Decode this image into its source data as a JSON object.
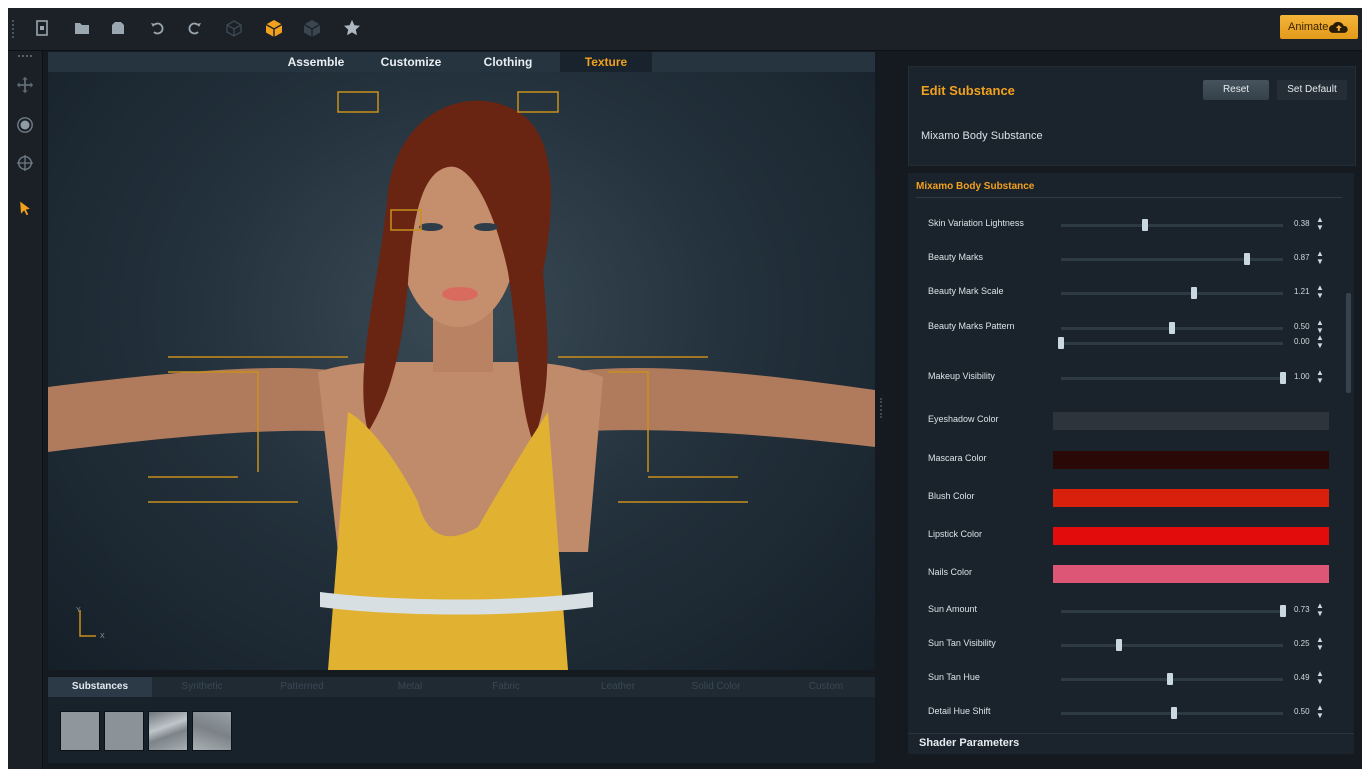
{
  "toolbar": {
    "icons": [
      "new-file-icon",
      "open-folder-icon",
      "save-icon",
      "undo-icon",
      "redo-icon",
      "wireframe-cube-icon",
      "solid-cube-icon",
      "textured-cube-icon",
      "star-icon"
    ],
    "animate_label": "Animate",
    "accent": "#f2a11e"
  },
  "left_tools": [
    "move-icon",
    "rotate-icon",
    "target-icon",
    "cursor-icon"
  ],
  "viewport": {
    "tabs": [
      {
        "label": "Assemble",
        "active": false
      },
      {
        "label": "Customize",
        "active": false
      },
      {
        "label": "Clothing",
        "active": false
      },
      {
        "label": "Texture",
        "active": true
      }
    ],
    "axis_y": "Y",
    "axis_x": "X"
  },
  "bottom_panel": {
    "tabs": [
      "Substances",
      "Synthetic",
      "Patterned",
      "Metal",
      "Fabric",
      "Leather",
      "Solid Color",
      "Custom"
    ],
    "active_tab": "Substances",
    "swatch_colors": [
      "#8f969c",
      "#8b9398",
      "#a1a8ad",
      "#9aa1a6"
    ]
  },
  "edit_substance": {
    "title": "Edit Substance",
    "reset_label": "Reset",
    "set_default_label": "Set Default",
    "substance_name": "Mixamo Body Substance"
  },
  "substance_panel": {
    "header": "Mixamo Body Substance",
    "params": [
      {
        "label": "Skin Variation Lightness",
        "kind": "slider",
        "value": "0.38",
        "fraction": 0.38
      },
      {
        "label": "Beauty Marks",
        "kind": "slider",
        "value": "0.87",
        "fraction": 0.84
      },
      {
        "label": "Beauty Mark Scale",
        "kind": "slider",
        "value": "1.21",
        "fraction": 0.6
      },
      {
        "label": "Beauty Marks Pattern",
        "kind": "slider",
        "value": "0.50",
        "fraction": 0.5
      },
      {
        "label": "",
        "kind": "slider",
        "value": "0.00",
        "fraction": 0.0
      },
      {
        "label": "Makeup Visibility",
        "kind": "slider",
        "value": "1.00",
        "fraction": 1.0
      },
      {
        "label": "Eyeshadow Color",
        "kind": "color",
        "color": "#2d343c"
      },
      {
        "label": "Mascara Color",
        "kind": "color",
        "color": "#2a0806"
      },
      {
        "label": "Blush Color",
        "kind": "color",
        "color": "#d8200d"
      },
      {
        "label": "Lipstick Color",
        "kind": "color",
        "color": "#e30c0c"
      },
      {
        "label": "Nails Color",
        "kind": "color",
        "color": "#dd5676"
      },
      {
        "label": "Sun Amount",
        "kind": "slider",
        "value": "0.73",
        "fraction": 1.0
      },
      {
        "label": "Sun Tan Visibility",
        "kind": "slider",
        "value": "0.25",
        "fraction": 0.26
      },
      {
        "label": "Sun Tan Hue",
        "kind": "slider",
        "value": "0.49",
        "fraction": 0.49
      },
      {
        "label": "Detail Hue Shift",
        "kind": "slider",
        "value": "0.50",
        "fraction": 0.51
      }
    ]
  },
  "shader_parameters_label": "Shader Parameters"
}
